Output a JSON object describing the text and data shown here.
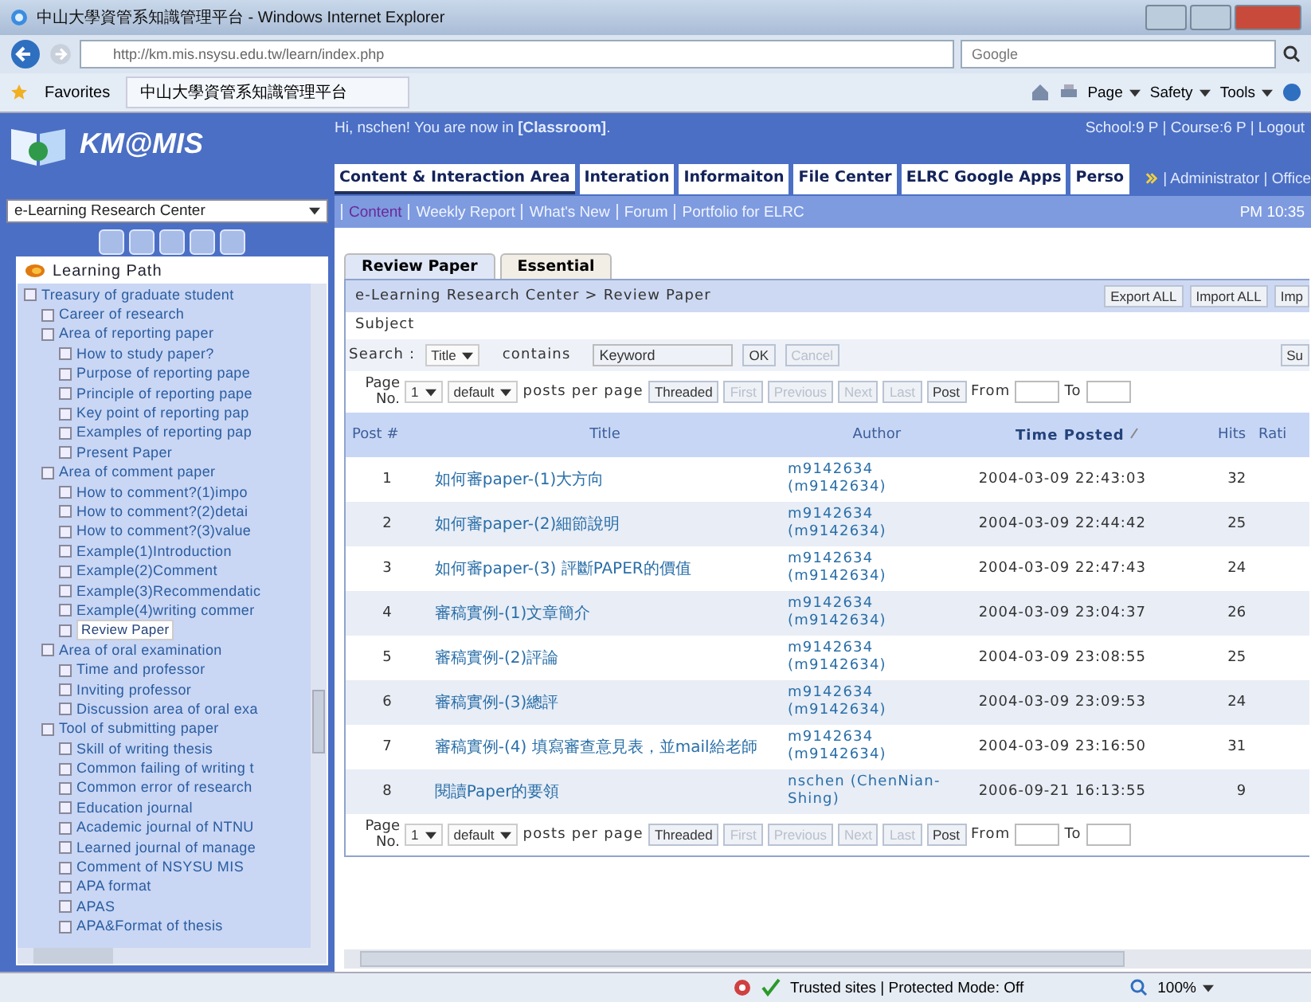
{
  "browser": {
    "title": "中山大學資管系知識管理平台 - Windows Internet Explorer",
    "address": "http://km.mis.nsysu.edu.tw/learn/index.php",
    "search_placeholder": "Google",
    "favorites": "Favorites",
    "tab_title": "中山大學資管系知識管理平台",
    "commands": [
      "Page",
      "Safety",
      "Tools"
    ]
  },
  "header": {
    "logo": "KM@MIS",
    "greeting": "Hi, nschen! You are now in **[Classroom]**.",
    "user_info": "School:9 P | Course:6 P | Logout",
    "tabs": [
      {
        "label": "Content & Interaction Area",
        "selected": true
      },
      {
        "label": "Interation",
        "selected": false
      },
      {
        "label": "Informaiton",
        "selected": false
      },
      {
        "label": "File Center",
        "selected": false
      },
      {
        "label": "ELRC Google Apps",
        "selected": false
      },
      {
        "label": "Perso",
        "selected": false
      }
    ],
    "admin_links": "| Administrator | Office",
    "subnav": [
      {
        "label": "Content",
        "selected": true
      },
      {
        "label": "Weekly Report",
        "selected": false
      },
      {
        "label": "What's New",
        "selected": false
      },
      {
        "label": "Forum",
        "selected": false
      },
      {
        "label": "Portfolio for ELRC",
        "selected": false
      }
    ],
    "time": "PM 10:35"
  },
  "sidebar": {
    "course": "e-Learning Research Center",
    "title": "Learning Path",
    "tree": [
      {
        "label": "Treasury of graduate student",
        "selected": false,
        "children": [
          {
            "label": "Career of research",
            "selected": false
          },
          {
            "label": "Area of reporting paper",
            "selected": false,
            "children": [
              {
                "label": "How to study paper?",
                "selected": false
              },
              {
                "label": "Purpose of reporting pape",
                "selected": false
              },
              {
                "label": "Principle of reporting pape",
                "selected": false
              },
              {
                "label": "Key point of reporting pap",
                "selected": false
              },
              {
                "label": "Examples of reporting pap",
                "selected": false
              },
              {
                "label": "Present Paper",
                "selected": false
              }
            ]
          },
          {
            "label": "Area of comment paper",
            "selected": false,
            "children": [
              {
                "label": "How to comment?(1)impo",
                "selected": false
              },
              {
                "label": "How to comment?(2)detai",
                "selected": false
              },
              {
                "label": "How to comment?(3)value",
                "selected": false
              },
              {
                "label": "Example(1)Introduction",
                "selected": false
              },
              {
                "label": "Example(2)Comment",
                "selected": false
              },
              {
                "label": "Example(3)Recommendatic",
                "selected": false
              },
              {
                "label": "Example(4)writing commer",
                "selected": false
              },
              {
                "label": "Review Paper",
                "selected": true
              }
            ]
          },
          {
            "label": "Area of oral examination",
            "selected": false,
            "children": [
              {
                "label": "Time and professor",
                "selected": false
              },
              {
                "label": "Inviting professor",
                "selected": false
              },
              {
                "label": "Discussion area of oral exa",
                "selected": false
              }
            ]
          },
          {
            "label": "Tool of submitting paper",
            "selected": false,
            "children": [
              {
                "label": "Skill of writing thesis",
                "selected": false
              },
              {
                "label": "Common failing of writing t",
                "selected": false
              },
              {
                "label": "Common error of research",
                "selected": false
              },
              {
                "label": "Education journal",
                "selected": false
              },
              {
                "label": "Academic journal of NTNU",
                "selected": false
              },
              {
                "label": "Learned journal of manage",
                "selected": false
              },
              {
                "label": "Comment of NSYSU MIS",
                "selected": false
              },
              {
                "label": "APA format",
                "selected": false
              },
              {
                "label": "APAS",
                "selected": false
              },
              {
                "label": "APA&Format of thesis",
                "selected": false
              }
            ]
          }
        ]
      }
    ]
  },
  "main": {
    "tabs": [
      {
        "label": "Review Paper",
        "selected": true
      },
      {
        "label": "Essential",
        "selected": false
      }
    ],
    "breadcrumb": "e-Learning Research Center > Review Paper",
    "actions": [
      "Export ALL",
      "Import ALL",
      "Imp"
    ],
    "subject_label": "Subject",
    "search": {
      "label": "Search :",
      "field": "Title",
      "operator": "contains",
      "value": "Keyword",
      "buttons": [
        {
          "label": "OK",
          "disabled": false
        },
        {
          "label": "Cancel",
          "disabled": true
        }
      ],
      "submit": "Su"
    },
    "pagers": [
      {
        "label": "Page No.",
        "page": "1",
        "per_page": "default",
        "per_page_label": "posts per page",
        "buttons": [
          {
            "label": "Threaded",
            "disabled": false
          },
          {
            "label": "First",
            "disabled": true
          },
          {
            "label": "Previous",
            "disabled": true
          },
          {
            "label": "Next",
            "disabled": true
          },
          {
            "label": "Last",
            "disabled": true
          },
          {
            "label": "Post",
            "disabled": false
          }
        ],
        "from_label": "From",
        "to_label": "To"
      },
      {
        "label": "Page No.",
        "page": "1",
        "per_page": "default",
        "per_page_label": "posts per page",
        "buttons": [
          {
            "label": "Threaded",
            "disabled": false
          },
          {
            "label": "First",
            "disabled": true
          },
          {
            "label": "Previous",
            "disabled": true
          },
          {
            "label": "Next",
            "disabled": true
          },
          {
            "label": "Last",
            "disabled": true
          },
          {
            "label": "Post",
            "disabled": false
          }
        ],
        "from_label": "From",
        "to_label": "To"
      }
    ],
    "table": {
      "columns": [
        {
          "label": "Post #",
          "sorted": false
        },
        {
          "label": "Title",
          "sorted": false
        },
        {
          "label": "Author",
          "sorted": false
        },
        {
          "label": "Time Posted",
          "sorted": true
        },
        {
          "label": "Hits",
          "sorted": false
        },
        {
          "label": "Rati",
          "sorted": false
        }
      ],
      "rows": [
        {
          "post": "1",
          "title": "如何審paper-(1)大方向",
          "author": "m9142634 (m9142634)",
          "time": "2004-03-09 22:43:03",
          "hits": "32"
        },
        {
          "post": "2",
          "title": "如何審paper-(2)細節說明",
          "author": "m9142634 (m9142634)",
          "time": "2004-03-09 22:44:42",
          "hits": "25"
        },
        {
          "post": "3",
          "title": "如何審paper-(3) 評斷PAPER的價值",
          "author": "m9142634 (m9142634)",
          "time": "2004-03-09 22:47:43",
          "hits": "24"
        },
        {
          "post": "4",
          "title": "審稿實例-(1)文章簡介",
          "author": "m9142634 (m9142634)",
          "time": "2004-03-09 23:04:37",
          "hits": "26"
        },
        {
          "post": "5",
          "title": "審稿實例-(2)評論",
          "author": "m9142634 (m9142634)",
          "time": "2004-03-09 23:08:55",
          "hits": "25"
        },
        {
          "post": "6",
          "title": "審稿實例-(3)總評",
          "author": "m9142634 (m9142634)",
          "time": "2004-03-09 23:09:53",
          "hits": "24"
        },
        {
          "post": "7",
          "title": "審稿實例-(4) 填寫審查意見表，並mail給老師",
          "author": "m9142634 (m9142634)",
          "time": "2004-03-09 23:16:50",
          "hits": "31"
        },
        {
          "post": "8",
          "title": "閱讀Paper的要領",
          "author": "nschen (ChenNian-Shing)",
          "time": "2006-09-21 16:13:55",
          "hits": "9"
        }
      ]
    }
  },
  "status_bar": {
    "zone": "Trusted sites | Protected Mode: Off",
    "zoom": "100%"
  }
}
